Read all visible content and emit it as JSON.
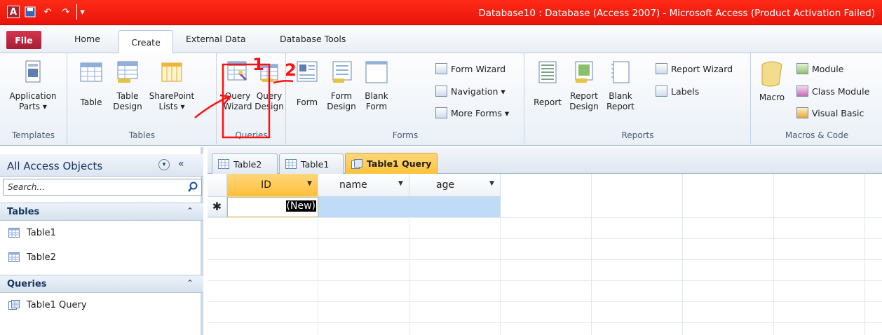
{
  "window": {
    "app_icon": "A",
    "title": "Database10 : Database (Access 2007)  -  Microsoft Access (Product Activation Failed)"
  },
  "quick_access": {
    "save_icon": "save-icon",
    "undo_icon": "undo-icon",
    "redo_icon": "redo-icon",
    "customize_icon": "customize-icon"
  },
  "tabs": {
    "file": "File",
    "home": "Home",
    "create": "Create",
    "external_data": "External Data",
    "database_tools": "Database Tools"
  },
  "ribbon": {
    "templates": {
      "label": "Templates",
      "application_parts": "Application",
      "application_parts2": "Parts ▾"
    },
    "tables": {
      "label": "Tables",
      "table": "Table",
      "table_design": "Table",
      "table_design2": "Design",
      "sharepoint": "SharePoint",
      "sharepoint2": "Lists ▾"
    },
    "queries": {
      "label": "Queries",
      "query_wizard": "Query",
      "query_wizard2": "Wizard",
      "query_design": "Query",
      "query_design2": "Design"
    },
    "forms": {
      "label": "Forms",
      "form": "Form",
      "form_design": "Form",
      "form_design2": "Design",
      "blank_form": "Blank",
      "blank_form2": "Form",
      "form_wizard": "Form Wizard",
      "navigation": "Navigation ▾",
      "more_forms": "More Forms ▾"
    },
    "reports": {
      "label": "Reports",
      "report": "Report",
      "report_design": "Report",
      "report_design2": "Design",
      "blank_report": "Blank",
      "blank_report2": "Report",
      "report_wizard": "Report Wizard",
      "labels": "Labels"
    },
    "macros": {
      "label": "Macros & Code",
      "macro": "Macro",
      "module": "Module",
      "class_module": "Class Module",
      "visual_basic": "Visual Basic"
    }
  },
  "annotations": {
    "mark1": "1",
    "mark2": "2"
  },
  "nav": {
    "header": "All Access Objects",
    "search_placeholder": "Search...",
    "sections": [
      {
        "label": "Tables",
        "collapse": "≈",
        "items": [
          "Table1",
          "Table2"
        ]
      },
      {
        "label": "Queries",
        "collapse": "≈",
        "items": [
          "Table1 Query"
        ]
      }
    ]
  },
  "doc_tabs": [
    "Table2",
    "Table1",
    "Table1 Query"
  ],
  "datasheet": {
    "columns": [
      "ID",
      "name",
      "age"
    ],
    "new_row_marker": "✱",
    "new_row_value": "(New)"
  },
  "colors": {
    "title_red": "#e8140a",
    "accent_blue": "#15355e",
    "active_tab": "#ffc33a",
    "selected_cell": "#bfdbf7"
  }
}
